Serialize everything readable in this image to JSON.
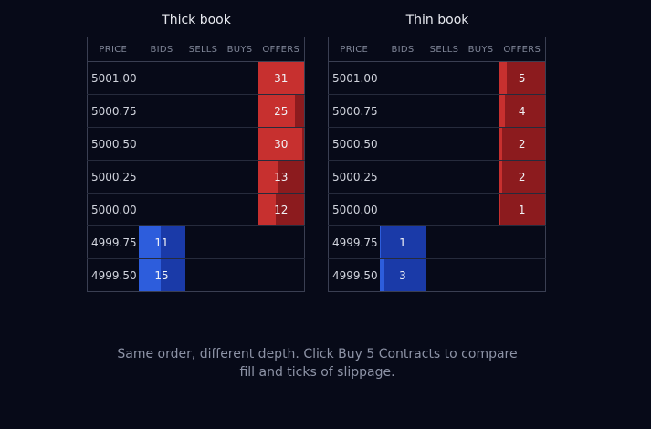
{
  "books": [
    {
      "title": "Thick book",
      "headers": [
        "PRICE",
        "BIDS",
        "SELLS",
        "BUYS",
        "OFFERS"
      ],
      "rows": [
        {
          "price": "5001.00",
          "bids": "",
          "offers": "31",
          "depth": 1.0
        },
        {
          "price": "5000.75",
          "bids": "",
          "offers": "25",
          "depth": 0.8
        },
        {
          "price": "5000.50",
          "bids": "",
          "offers": "30",
          "depth": 0.96
        },
        {
          "price": "5000.25",
          "bids": "",
          "offers": "13",
          "depth": 0.42
        },
        {
          "price": "5000.00",
          "bids": "",
          "offers": "12",
          "depth": 0.39
        },
        {
          "price": "4999.75",
          "bids": "11",
          "offers": "",
          "depth": 0.49
        },
        {
          "price": "4999.50",
          "bids": "15",
          "offers": "",
          "depth": 0.49
        }
      ]
    },
    {
      "title": "Thin book",
      "headers": [
        "PRICE",
        "BIDS",
        "SELLS",
        "BUYS",
        "OFFERS"
      ],
      "rows": [
        {
          "price": "5001.00",
          "bids": "",
          "offers": "5",
          "depth": 0.16
        },
        {
          "price": "5000.75",
          "bids": "",
          "offers": "4",
          "depth": 0.13
        },
        {
          "price": "5000.50",
          "bids": "",
          "offers": "2",
          "depth": 0.06
        },
        {
          "price": "5000.25",
          "bids": "",
          "offers": "2",
          "depth": 0.06
        },
        {
          "price": "5000.00",
          "bids": "",
          "offers": "1",
          "depth": 0.03
        },
        {
          "price": "4999.75",
          "bids": "1",
          "offers": "",
          "depth": 0.03
        },
        {
          "price": "4999.50",
          "bids": "3",
          "offers": "",
          "depth": 0.1
        }
      ]
    }
  ],
  "caption": "Same order, different depth. Click Buy 5 Contracts to compare fill and ticks of slippage.",
  "colors": {
    "background": "#070a18",
    "offer_base": "#8c1b1e",
    "offer_fill": "#c7302f",
    "bid_base": "#1a3aa8",
    "bid_fill": "#2d5ddc"
  }
}
